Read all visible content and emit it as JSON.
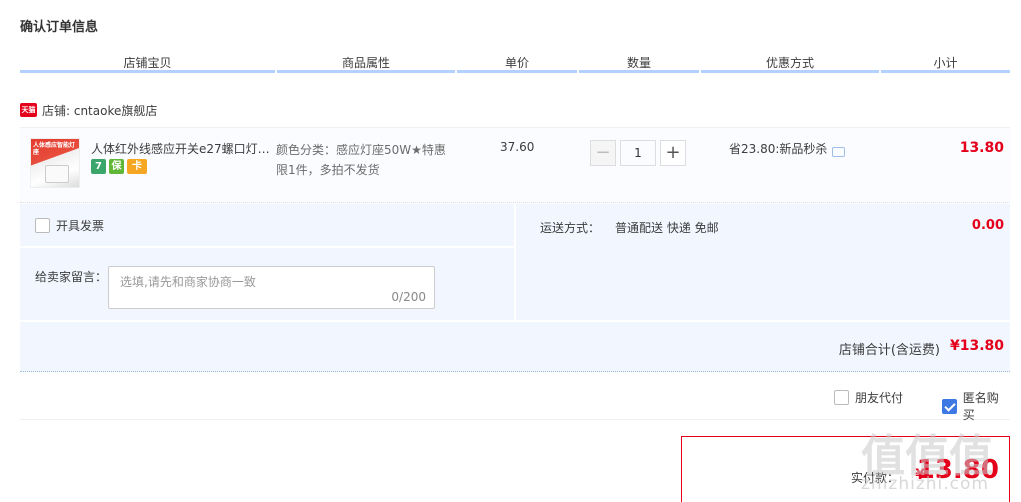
{
  "page_title": "确认订单信息",
  "columns": [
    "店铺宝贝",
    "商品属性",
    "单价",
    "数量",
    "优惠方式",
    "小计"
  ],
  "shop": {
    "badge": "天猫",
    "label": "店铺: cntaoke旗舰店"
  },
  "item": {
    "thumbnail_text": "人体感应智能灯座",
    "title": "人体红外线感应开关e27螺口灯…",
    "badges": [
      "7",
      "保",
      "卡"
    ],
    "props_line1": "颜色分类：感应灯座50W★特惠",
    "props_line2": "限1件，多拍不发货",
    "price": "37.60",
    "qty_minus": "−",
    "quantity": "1",
    "qty_plus": "+",
    "promo": "省23.80:新品秒杀",
    "subtotal": "13.80"
  },
  "invoice_label": "开具发票",
  "message": {
    "label": "给卖家留言：",
    "placeholder": "选填,请先和商家协商一致",
    "count": "0/200"
  },
  "shipping": {
    "label": "运送方式：",
    "value": "普通配送 快递 免邮",
    "fee": "0.00"
  },
  "shop_total": {
    "label": "店铺合计(含运费)",
    "value": "¥13.80"
  },
  "options": {
    "friend_pay": "朋友代付",
    "anonymous": "匿名购买",
    "anonymous_checked": true
  },
  "payment": {
    "label": "实付款：",
    "yen": "¥",
    "value": "13.80"
  },
  "watermark": {
    "glyphs": "值值值",
    "text": "zhizhizhi.com"
  },
  "colors": {
    "accent_red": "#e4001b",
    "header_underline": "#b2d1ff",
    "panel_bg": "#f2f7ff"
  }
}
